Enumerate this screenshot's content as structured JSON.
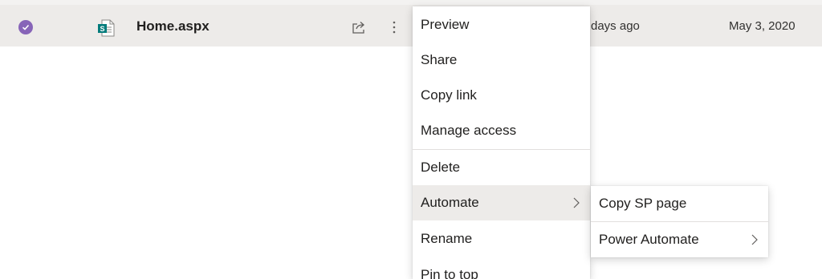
{
  "file_row": {
    "name": "Home.aspx",
    "modified": "days ago",
    "date": "May 3, 2020",
    "file_icon_letter": "S",
    "selected": true,
    "colors": {
      "check": "#8764b8",
      "sharepoint": "#037c7c",
      "row_bg": "#edebe9"
    }
  },
  "context_menu": {
    "items": [
      {
        "label": "Preview"
      },
      {
        "label": "Share"
      },
      {
        "label": "Copy link"
      },
      {
        "label": "Manage access"
      },
      {
        "label": "Delete"
      },
      {
        "label": "Automate"
      },
      {
        "label": "Rename"
      },
      {
        "label": "Pin to top"
      }
    ]
  },
  "automate_submenu": {
    "items": [
      {
        "label": "Copy SP page"
      },
      {
        "label": "Power Automate"
      }
    ]
  }
}
